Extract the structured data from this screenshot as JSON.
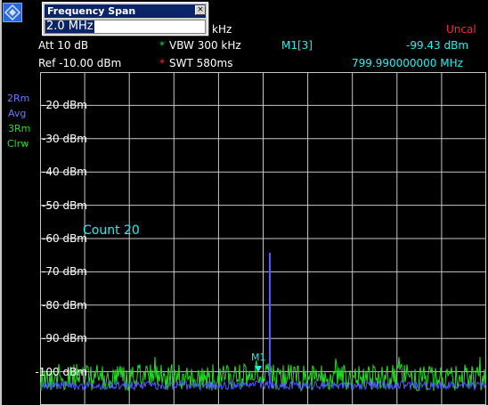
{
  "dialog": {
    "title": "Frequency Span",
    "close_glyph": "×",
    "value": "2.0 MHz",
    "unit_hint": "kHz"
  },
  "status": {
    "uncal": "Uncal"
  },
  "settings": {
    "att": "Att  10 dB",
    "ref": "Ref  -10.00 dBm",
    "vbw": "VBW 300 kHz",
    "swt": "SWT 580ms",
    "vbw_star": "*",
    "swt_star": "*"
  },
  "marker": {
    "name": "M1[3]",
    "level": "-99.43 dBm",
    "freq": "799.990000000 MHz",
    "plot_label": "M1"
  },
  "trace_info": {
    "t2": "2Rm",
    "t2_mode": "Avg",
    "t3": "3Rm",
    "t3_mode": "Clrw"
  },
  "count_label": "Count 20",
  "y_labels": [
    "-20 dBm",
    "-30 dBm",
    "-40 dBm",
    "-50 dBm",
    "-60 dBm",
    "-70 dBm",
    "-80 dBm",
    "-90 dBm",
    "-100 dBm"
  ],
  "colors": {
    "grid": "#c8c8c8",
    "trace_green": "#22e022",
    "trace_blue": "#4a5cff",
    "cyan": "#22f0f0",
    "uncal_red": "#ff2a2a"
  },
  "icons": {
    "logo": "rohde-schwarz-logo-icon"
  }
}
